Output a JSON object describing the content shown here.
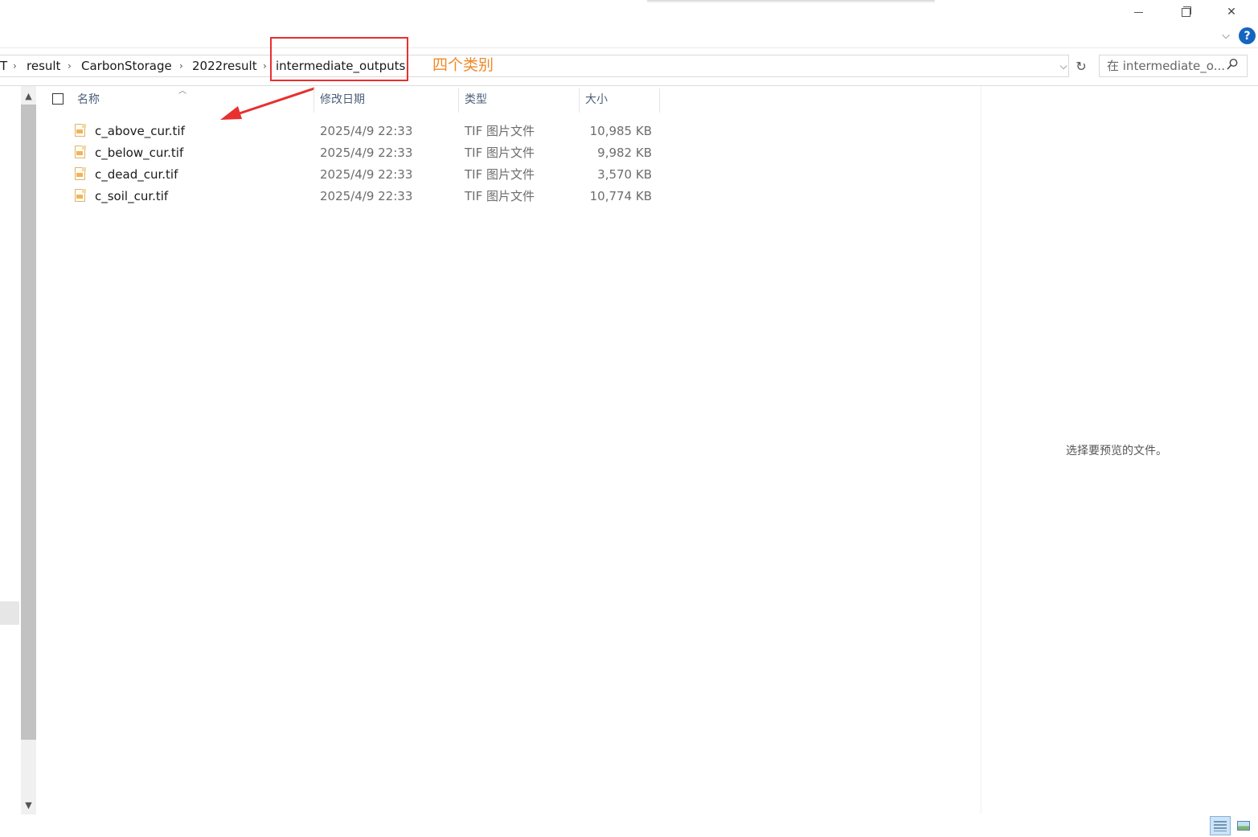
{
  "window": {
    "minimize_icon": "minimize-icon",
    "maximize_icon": "restore-icon",
    "close_glyph": "✕",
    "ribbon_glyph": "⌵",
    "help_label": "?"
  },
  "address_bar": {
    "crumbs": [
      {
        "label": "T"
      },
      {
        "label": "result"
      },
      {
        "label": "CarbonStorage"
      },
      {
        "label": "2022result"
      },
      {
        "label": "intermediate_outputs"
      }
    ],
    "separator": "›",
    "dropdown_glyph": "⌵",
    "refresh_glyph": "↻"
  },
  "search": {
    "placeholder": "在 intermediate_o..."
  },
  "annotation": {
    "text": "四个类别",
    "color": "#ee8a2a",
    "box_color": "#e8302f"
  },
  "columns": {
    "name": "名称",
    "date": "修改日期",
    "type": "类型",
    "size": "大小"
  },
  "files": [
    {
      "name": "c_above_cur.tif",
      "date": "2025/4/9 22:33",
      "type": "TIF 图片文件",
      "size": "10,985 KB"
    },
    {
      "name": "c_below_cur.tif",
      "date": "2025/4/9 22:33",
      "type": "TIF 图片文件",
      "size": "9,982 KB"
    },
    {
      "name": "c_dead_cur.tif",
      "date": "2025/4/9 22:33",
      "type": "TIF 图片文件",
      "size": "3,570 KB"
    },
    {
      "name": "c_soil_cur.tif",
      "date": "2025/4/9 22:33",
      "type": "TIF 图片文件",
      "size": "10,774 KB"
    }
  ],
  "preview": {
    "message": "选择要预览的文件。"
  }
}
